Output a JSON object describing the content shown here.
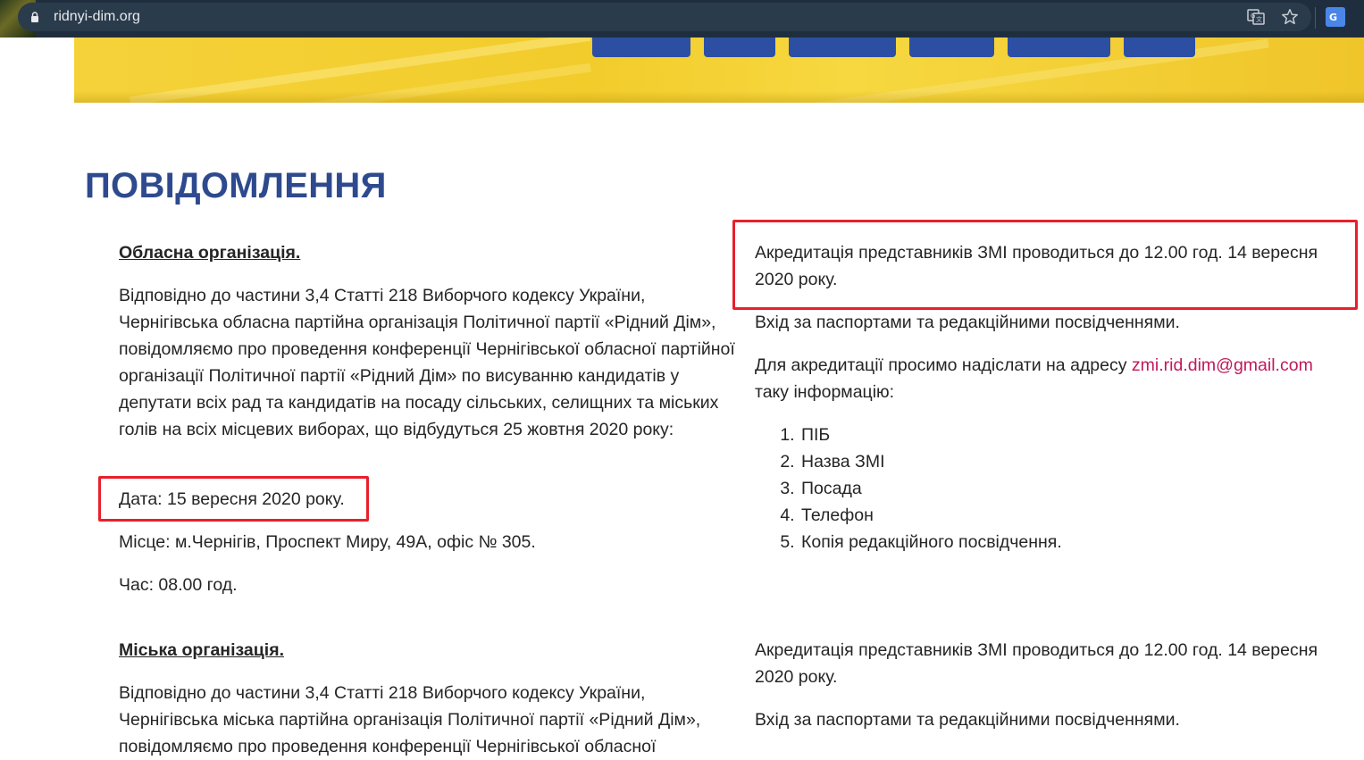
{
  "browser": {
    "url": "ridnyi-dim.org"
  },
  "page": {
    "title": "ПОВІДОМЛЕННЯ"
  },
  "regional": {
    "heading": "Обласна організація.",
    "intro": "Відповідно до частини 3,4 Статті 218 Виборчого кодексу України, Чернігівська обласна партійна організація Політичної партії «Рідний Дім», повідомляємо про проведення конференції Чернігівської обласної партійної організації Політичної партії «Рідний Дім» по висуванню кандидатів у депутати всіх рад та кандидатів на посаду сільських, селищних та міських голів на всіх місцевих виборах, що відбудуться 25 жовтня 2020 року:",
    "date": "Дата: 15 вересня 2020 року.",
    "place": "Місце: м.Чернігів, Проспект Миру, 49А, офіс № 305.",
    "time": "Час: 08.00 год.",
    "accreditation": "Акредитація представників ЗМІ проводиться до 12.00 год. 14 вересня 2020 року.",
    "entry": "Вхід за паспортами та редакційними посвідченнями.",
    "request_before": "Для акредитації просимо надіслати на адресу ",
    "email": "zmi.rid.dim@gmail.com",
    "request_after": "таку інформацію:",
    "list": [
      "ПІБ",
      "Назва ЗМІ",
      "Посада",
      "Телефон",
      "Копія редакційного посвідчення."
    ]
  },
  "city": {
    "heading": "Міська організація.",
    "intro_line1": "Відповідно до частини 3,4 Статті 218 Виборчого кодексу України,",
    "intro_line2": "Чернігівська міська партійна організація Політичної партії «Рідний Дім»,",
    "intro_line3": "повідомляємо про проведення конференції Чернігівської обласної",
    "accreditation": "Акредитація представників ЗМІ проводиться до 12.00 год. 14 вересня 2020 року.",
    "entry": "Вхід за паспортами та редакційними посвідченнями."
  },
  "colors": {
    "title": "#2e4a8e",
    "highlight": "#e8202a",
    "link": "#c2185b"
  }
}
